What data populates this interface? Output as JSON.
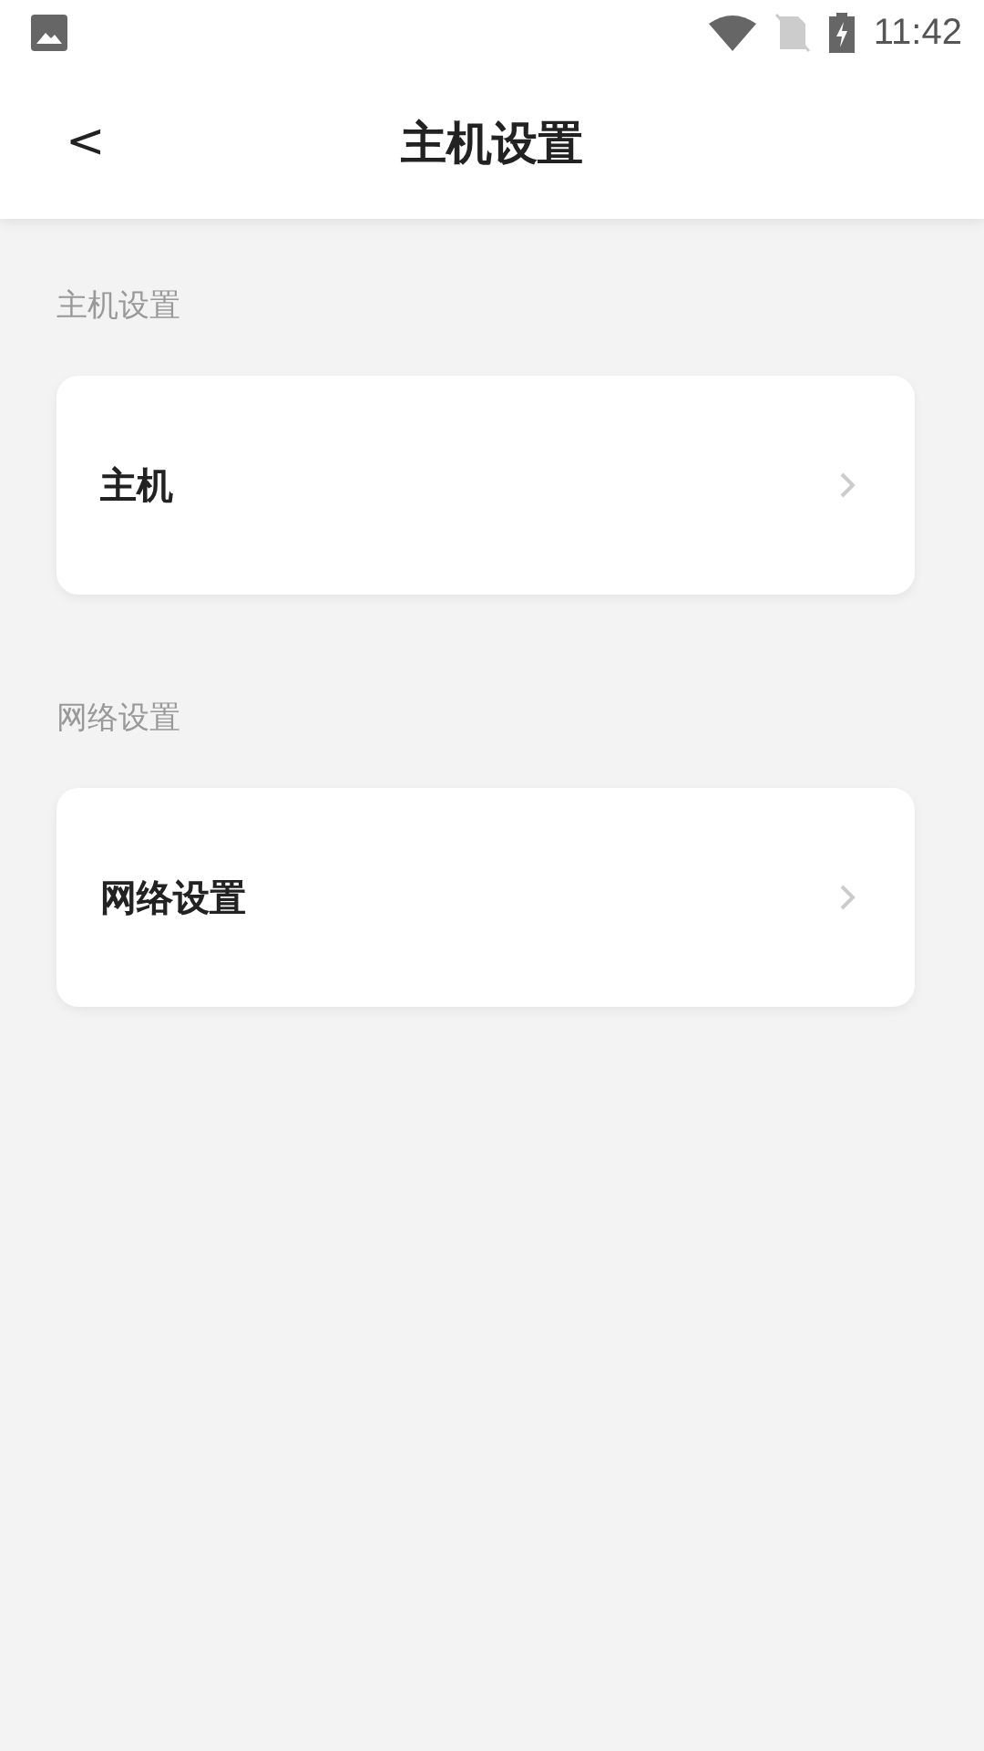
{
  "status_bar": {
    "time": "11:42"
  },
  "header": {
    "back": "<",
    "title": "主机设置"
  },
  "sections": [
    {
      "heading": "主机设置",
      "items": [
        {
          "label": "主机"
        }
      ]
    },
    {
      "heading": "网络设置",
      "items": [
        {
          "label": "网络设置"
        }
      ]
    }
  ]
}
